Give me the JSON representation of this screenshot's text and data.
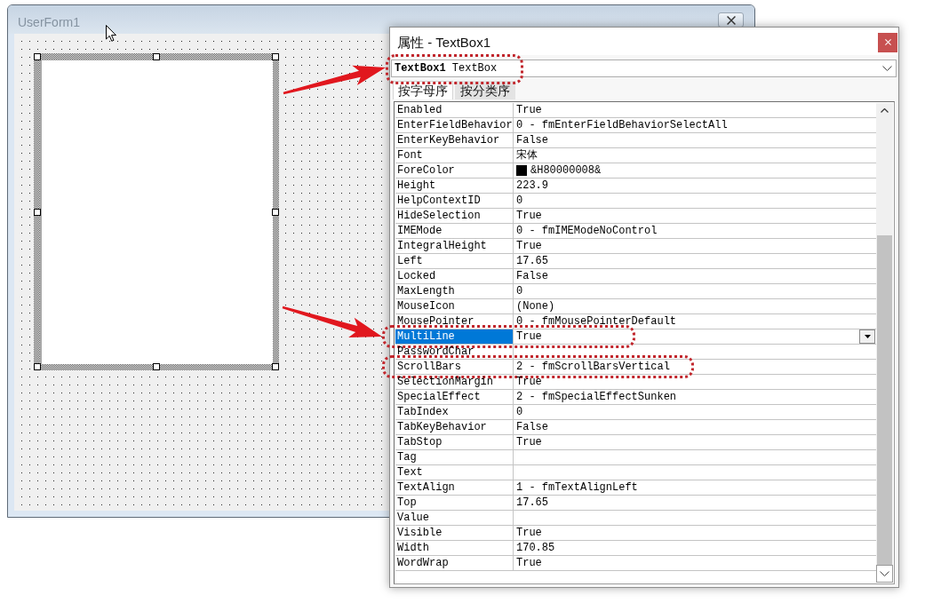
{
  "designer": {
    "title": "UserForm1",
    "text_box": {
      "selected": true
    }
  },
  "properties_window": {
    "title": "属性 - TextBox1",
    "object_selector": {
      "value": "**TextBox1** TextBox",
      "highlighted": true,
      "arrow": true
    },
    "tabs": [
      {
        "label": "按字母序",
        "selected": true
      },
      {
        "label": "按分类序",
        "selected": false
      }
    ],
    "properties": [
      {
        "name": "Enabled",
        "value": "True",
        "selected": false,
        "highlighted": false,
        "arrow": false
      },
      {
        "name": "EnterFieldBehavior",
        "value": "0 - fmEnterFieldBehaviorSelectAll",
        "selected": false,
        "highlighted": false,
        "arrow": false
      },
      {
        "name": "EnterKeyBehavior",
        "value": "False",
        "selected": false,
        "highlighted": false,
        "arrow": false
      },
      {
        "name": "Font",
        "value": "宋体",
        "selected": false,
        "highlighted": false,
        "arrow": false
      },
      {
        "name": "ForeColor",
        "value": "&H80000008&",
        "color": "#000000",
        "selected": false,
        "highlighted": false,
        "arrow": false
      },
      {
        "name": "Height",
        "value": "223.9",
        "selected": false,
        "highlighted": false,
        "arrow": false
      },
      {
        "name": "HelpContextID",
        "value": "0",
        "selected": false,
        "highlighted": false,
        "arrow": false
      },
      {
        "name": "HideSelection",
        "value": "True",
        "selected": false,
        "highlighted": false,
        "arrow": false
      },
      {
        "name": "IMEMode",
        "value": "0 - fmIMEModeNoControl",
        "selected": false,
        "highlighted": false,
        "arrow": false
      },
      {
        "name": "IntegralHeight",
        "value": "True",
        "selected": false,
        "highlighted": false,
        "arrow": false
      },
      {
        "name": "Left",
        "value": "17.65",
        "selected": false,
        "highlighted": false,
        "arrow": false
      },
      {
        "name": "Locked",
        "value": "False",
        "selected": false,
        "highlighted": false,
        "arrow": false
      },
      {
        "name": "MaxLength",
        "value": "0",
        "selected": false,
        "highlighted": false,
        "arrow": false
      },
      {
        "name": "MouseIcon",
        "value": "(None)",
        "selected": false,
        "highlighted": false,
        "arrow": false
      },
      {
        "name": "MousePointer",
        "value": "0 - fmMousePointerDefault",
        "selected": false,
        "highlighted": false,
        "arrow": false
      },
      {
        "name": "MultiLine",
        "value": "True",
        "selected": true,
        "highlighted": true,
        "arrow": true
      },
      {
        "name": "PasswordChar",
        "selected": false,
        "highlighted": false,
        "arrow": false
      },
      {
        "name": "ScrollBars",
        "value": "2 - fmScrollBarsVertical",
        "selected": false,
        "highlighted": true,
        "arrow": false
      },
      {
        "name": "SelectionMargin",
        "value": "True",
        "selected": false,
        "highlighted": false,
        "arrow": false
      },
      {
        "name": "SpecialEffect",
        "value": "2 - fmSpecialEffectSunken",
        "selected": false,
        "highlighted": false,
        "arrow": false
      },
      {
        "name": "TabIndex",
        "value": "0",
        "selected": false,
        "highlighted": false,
        "arrow": false
      },
      {
        "name": "TabKeyBehavior",
        "value": "False",
        "selected": false,
        "highlighted": false,
        "arrow": false
      },
      {
        "name": "TabStop",
        "value": "True",
        "selected": false,
        "highlighted": false,
        "arrow": false
      },
      {
        "name": "Tag",
        "selected": false,
        "highlighted": false,
        "arrow": false
      },
      {
        "name": "Text",
        "selected": false,
        "highlighted": false,
        "arrow": false
      },
      {
        "name": "TextAlign",
        "value": "1 - fmTextAlignLeft",
        "selected": false,
        "highlighted": false,
        "arrow": false
      },
      {
        "name": "Top",
        "value": "17.65",
        "selected": false,
        "highlighted": false,
        "arrow": false
      },
      {
        "name": "Value",
        "selected": false,
        "highlighted": false,
        "arrow": false
      },
      {
        "name": "Visible",
        "value": "True",
        "selected": false,
        "highlighted": false,
        "arrow": false
      },
      {
        "name": "Width",
        "value": "170.85",
        "selected": false,
        "highlighted": false,
        "arrow": false
      },
      {
        "name": "WordWrap",
        "value": "True",
        "selected": false,
        "highlighted": false,
        "arrow": false
      }
    ]
  }
}
